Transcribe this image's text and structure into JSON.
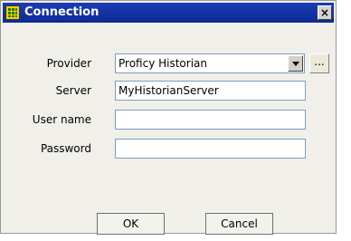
{
  "window": {
    "title": "Connection",
    "close_glyph": "×"
  },
  "form": {
    "provider": {
      "label": "Provider",
      "value": "Proficy Historian"
    },
    "server": {
      "label": "Server",
      "value": "MyHistorianServer"
    },
    "username": {
      "label": "User name",
      "value": ""
    },
    "password": {
      "label": "Password",
      "value": ""
    },
    "browse_label": "..."
  },
  "buttons": {
    "ok_label": "OK",
    "cancel_label": "Cancel"
  },
  "icons": {
    "title_icon": "grid-table-icon",
    "dropdown": "chevron-down-icon",
    "close": "close-icon"
  },
  "colors": {
    "titlebar": "#1a3cb5",
    "dialog_bg": "#f0efe9"
  }
}
